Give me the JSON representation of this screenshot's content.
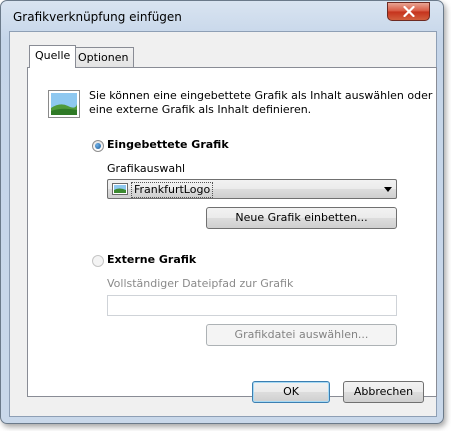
{
  "window": {
    "title": "Grafikverknüpfung einfügen"
  },
  "tabs": [
    {
      "label": "Quelle"
    },
    {
      "label": "Optionen"
    }
  ],
  "description": {
    "line1": "Sie können eine eingebettete Grafik als Inhalt auswählen oder",
    "line2": "eine externe Grafik als Inhalt definieren."
  },
  "embedded": {
    "radio_label": "Eingebettete Grafik",
    "selected": true,
    "select_label": "Grafikauswahl",
    "selected_value": "FrankfurtLogo",
    "embed_button": "Neue Grafik einbetten..."
  },
  "external": {
    "radio_label": "Externe Grafik",
    "selected": false,
    "path_label": "Vollständiger Dateipfad zur Grafik",
    "path_value": "",
    "browse_button": "Grafikdatei auswählen..."
  },
  "footer": {
    "ok": "OK",
    "cancel": "Abbrechen"
  },
  "icons": {
    "close": "close-icon",
    "image": "image-icon",
    "dropdown": "chevron-down-icon"
  }
}
